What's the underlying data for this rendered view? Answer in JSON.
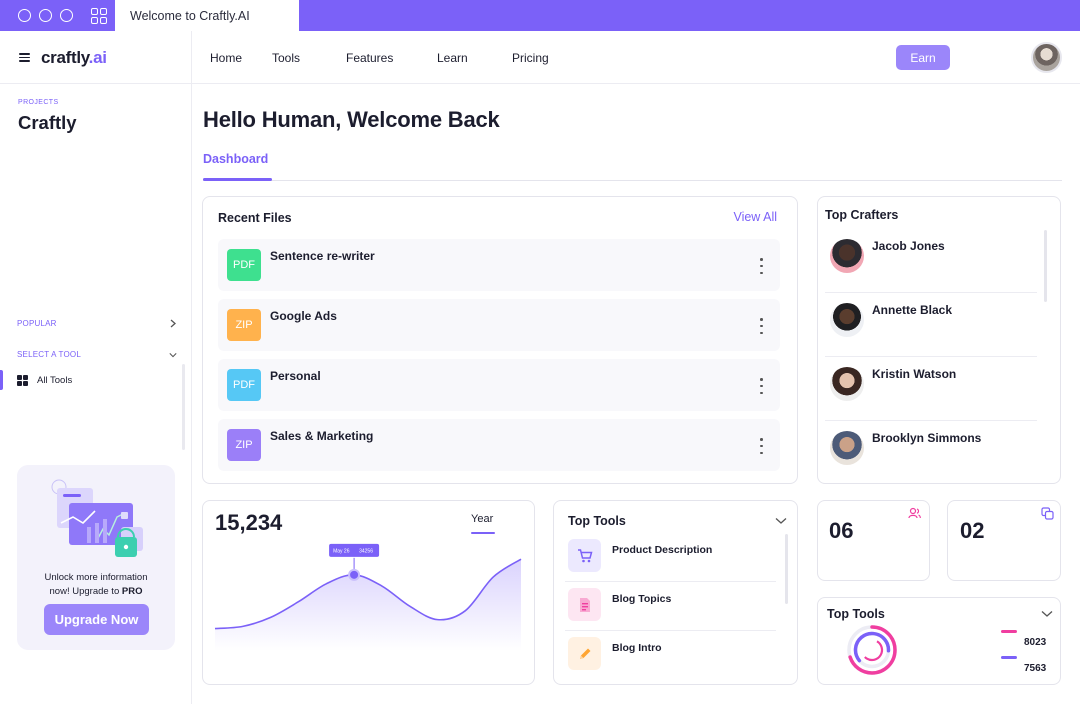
{
  "browser": {
    "tab_title": "Welcome to Craftly.AI"
  },
  "brand": {
    "name": "craftly",
    "suffix": ".ai"
  },
  "nav": {
    "links": [
      "Home",
      "Tools",
      "Features",
      "Learn",
      "Pricing"
    ],
    "earn_label": "Earn"
  },
  "sidebar": {
    "projects_label": "PROJECTS",
    "project_name": "Craftly",
    "popular_label": "POPULAR",
    "select_tool_label": "SELECT A TOOL",
    "all_tools_label": "All Tools",
    "upgrade": {
      "line1": "Unlock more information",
      "line2": "now! Upgrade to ",
      "pro": "PRO",
      "button": "Upgrade Now"
    }
  },
  "main": {
    "greeting": "Hello Human, Welcome Back",
    "tab_dashboard": "Dashboard",
    "recent_files": {
      "title": "Recent Files",
      "view_all": "View All",
      "files": [
        {
          "type": "PDF",
          "name": "Sentence re-writer",
          "color": "#3ee08f"
        },
        {
          "type": "ZIP",
          "name": "Google Ads",
          "color": "#ffb24d"
        },
        {
          "type": "PDF",
          "name": "Personal",
          "color": "#56c8f5"
        },
        {
          "type": "ZIP",
          "name": "Sales & Marketing",
          "color": "#9b7ff8"
        }
      ]
    },
    "top_crafters": {
      "title": "Top Crafters",
      "people": [
        {
          "name": "Jacob Jones",
          "bg": "#f1a7b4"
        },
        {
          "name": "Annette Black",
          "bg": "#eef0f4"
        },
        {
          "name": "Kristin Watson",
          "bg": "#eeeeee"
        },
        {
          "name": "Brooklyn Simmons",
          "bg": "#e9e3dc"
        }
      ]
    },
    "stats_chart": {
      "value": "15,234",
      "period": "Year",
      "tooltip_date": "May 26",
      "tooltip_value": "34256"
    },
    "top_tools_list": {
      "title": "Top Tools",
      "tools": [
        {
          "name": "Product Description",
          "icon": "cart-icon",
          "bg": "#ece9fe"
        },
        {
          "name": "Blog Topics",
          "icon": "document-icon",
          "bg": "#fde6f2"
        },
        {
          "name": "Blog Intro",
          "icon": "pencil-icon",
          "bg": "#fff1e2"
        }
      ]
    },
    "counters": [
      {
        "value": "06",
        "icon": "users-icon"
      },
      {
        "value": "02",
        "icon": "copy-icon"
      }
    ],
    "top_tools_ring": {
      "title": "Top Tools",
      "values": [
        "8023",
        "7563"
      ],
      "colors": [
        "#f03ea0",
        "#7b61f8"
      ]
    }
  },
  "chart_data": {
    "type": "area",
    "x": [
      0,
      1,
      2,
      3,
      4,
      5,
      6,
      7,
      8,
      9,
      10,
      11
    ],
    "values": [
      20,
      22,
      30,
      44,
      60,
      68,
      58,
      40,
      28,
      36,
      66,
      82
    ],
    "ylim": [
      0,
      100
    ],
    "highlight_index": 5,
    "color": "#7b61f8"
  }
}
